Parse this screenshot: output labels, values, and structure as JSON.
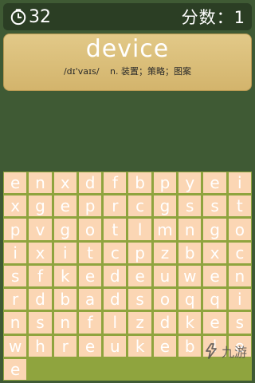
{
  "timer": {
    "value": "32",
    "icon": "clock-icon"
  },
  "score": {
    "label": "分数：1"
  },
  "word": {
    "text": "device",
    "phonetic": "/dɪ'vaɪs/",
    "meaning": "n. 装置；策略；图案"
  },
  "grid": [
    [
      "e",
      "n",
      "x",
      "d",
      "f",
      "b",
      "p",
      "y",
      "e"
    ],
    [
      "i",
      "x",
      "g",
      "e",
      "p",
      "r",
      "c",
      "g",
      "s"
    ],
    [
      "s",
      "t",
      "p",
      "v",
      "g",
      "o",
      "t",
      "l",
      "m"
    ],
    [
      "n",
      "g",
      "o",
      "i",
      "x",
      "i",
      "t",
      "c",
      "p"
    ],
    [
      "z",
      "b",
      "x",
      "c",
      "s",
      "f",
      "k",
      "e",
      "d"
    ],
    [
      "e",
      "u",
      "w",
      "e",
      "n",
      "r",
      "d",
      "b",
      "a"
    ],
    [
      "d",
      "s",
      "o",
      "q",
      "q",
      "i",
      "n",
      "s",
      "n"
    ],
    [
      "f",
      "l",
      "z",
      "d",
      "k",
      "e",
      "s",
      "w",
      "h"
    ],
    [
      "r",
      "e",
      "u",
      "k",
      "e",
      "b",
      "l",
      "e",
      "e"
    ]
  ],
  "watermark": {
    "text": "九游"
  }
}
